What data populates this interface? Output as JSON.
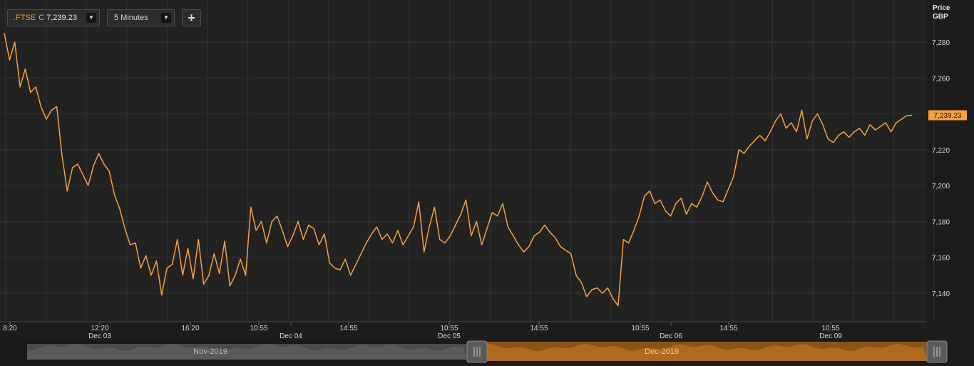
{
  "toolbar": {
    "ric": ".FTSE",
    "close_prefix": "C",
    "last_price": "7,239.23",
    "dropdown_glyph": "▼",
    "interval": "5 Minutes",
    "add_glyph": "+"
  },
  "colors": {
    "background": "#1c1c1c",
    "plot_background": "#222222",
    "grid": "#333333",
    "line": "#f6a040",
    "axis_text": "#d8d8d8",
    "navigator_active": "#b06a20",
    "navigator_inactive": "#555555"
  },
  "chart_data": {
    "type": "line",
    "title": "",
    "instrument": ".FTSE",
    "interval": "5 Minutes",
    "ylabel": "Price GBP",
    "y_axis_title": [
      "Price",
      "GBP"
    ],
    "ylim": [
      7125,
      7298
    ],
    "y_ticks": [
      7140,
      7160,
      7180,
      7200,
      7220,
      7240,
      7260,
      7280
    ],
    "y_tick_labels": [
      "7,140",
      "7,160",
      "7,180",
      "7,200",
      "7,220",
      "7,240",
      "7,260",
      "7,280"
    ],
    "last_value_label": "7,239.23",
    "last_value": 7239.23,
    "x_session_labels": [
      {
        "time": "8:20",
        "date": ""
      },
      {
        "time": "12:20",
        "date": "Dec 03"
      },
      {
        "time": "16:20",
        "date": ""
      },
      {
        "time": "10:55",
        "date": ""
      },
      {
        "time": "",
        "date": "Dec 04"
      },
      {
        "time": "14:55",
        "date": ""
      },
      {
        "time": "10:55",
        "date": "Dec 05"
      },
      {
        "time": "14:55",
        "date": ""
      },
      {
        "time": "10:55",
        "date": ""
      },
      {
        "time": "",
        "date": "Dec 06"
      },
      {
        "time": "14:55",
        "date": ""
      },
      {
        "time": "10:55",
        "date": "Dec 09"
      }
    ],
    "series": [
      {
        "values": [
          7285,
          7270,
          7280,
          7255,
          7265,
          7252,
          7255,
          7244,
          7237,
          7242,
          7244,
          7217,
          7197,
          7210,
          7212,
          7206,
          7200,
          7211,
          7218,
          7212,
          7208,
          7195,
          7187,
          7176,
          7167,
          7168,
          7154,
          7161,
          7150,
          7158,
          7139,
          7154,
          7156,
          7170,
          7150,
          7165,
          7148,
          7170,
          7145,
          7150,
          7162,
          7151,
          7169,
          7144,
          7150,
          7159,
          7150,
          7188,
          7175,
          7180,
          7168,
          7180,
          7183,
          7175,
          7166,
          7172,
          7180,
          7170,
          7178,
          7176,
          7167,
          7173,
          7157,
          7154,
          7153,
          7159,
          7150,
          7156,
          7162,
          7168,
          7173,
          7177,
          7170,
          7173,
          7168,
          7175,
          7167,
          7172,
          7177,
          7191,
          7163,
          7177,
          7188,
          7170,
          7168,
          7172,
          7178,
          7184,
          7192,
          7172,
          7180,
          7167,
          7176,
          7185,
          7183,
          7190,
          7177,
          7172,
          7167,
          7163,
          7166,
          7172,
          7174,
          7178,
          7174,
          7171,
          7166,
          7164,
          7162,
          7150,
          7146,
          7138,
          7142,
          7143,
          7140,
          7143,
          7137,
          7133,
          7170,
          7168,
          7175,
          7183,
          7194,
          7197,
          7190,
          7192,
          7186,
          7183,
          7190,
          7193,
          7184,
          7190,
          7188,
          7194,
          7202,
          7196,
          7192,
          7191,
          7198,
          7205,
          7220,
          7218,
          7222,
          7225,
          7228,
          7225,
          7230,
          7236,
          7240,
          7232,
          7235,
          7230,
          7242,
          7226,
          7236,
          7240,
          7234,
          7226,
          7224,
          7228,
          7230,
          7227,
          7230,
          7232,
          7228,
          7234,
          7231,
          7233,
          7235,
          7230,
          7235,
          7237,
          7239,
          7239.23
        ]
      }
    ]
  },
  "navigator": {
    "left_label": "Nov-2019",
    "right_label": "Dec-2019"
  }
}
